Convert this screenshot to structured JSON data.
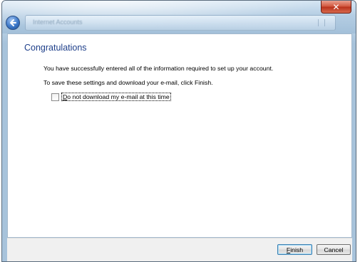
{
  "window": {
    "title": "Internet Accounts",
    "close_glyph": "✕"
  },
  "page": {
    "heading": "Congratulations",
    "line1": "You have successfully entered all of the information required to set up your account.",
    "line2": "To save these settings and download your e-mail, click Finish.",
    "checkbox_label": "Do not download my e-mail at this time",
    "checkbox_checked": false
  },
  "footer": {
    "finish_label": "Finish",
    "cancel_label": "Cancel"
  },
  "icons": {
    "back": "back-arrow-icon",
    "close": "close-icon"
  },
  "colors": {
    "heading": "#1e3f8a",
    "close_button": "#c8452c",
    "back_button": "#3c78c8"
  }
}
